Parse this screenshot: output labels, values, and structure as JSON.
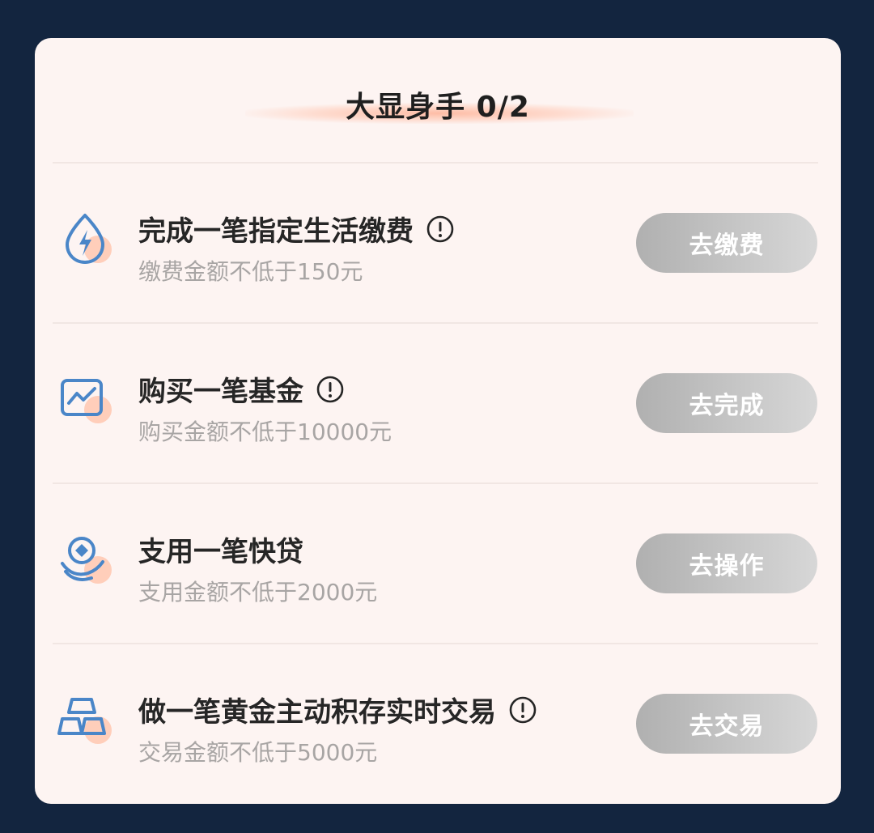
{
  "header": {
    "title": "大显身手 0/2"
  },
  "tasks": [
    {
      "icon": "water-drop-bolt-icon",
      "title": "完成一笔指定生活缴费",
      "has_info": true,
      "subtitle": "缴费金额不低于150元",
      "button_label": "去缴费"
    },
    {
      "icon": "fund-chart-icon",
      "title": "购买一笔基金",
      "has_info": true,
      "subtitle": "购买金额不低于10000元",
      "button_label": "去完成"
    },
    {
      "icon": "loan-coin-hand-icon",
      "title": "支用一笔快贷",
      "has_info": false,
      "subtitle": "支用金额不低于2000元",
      "button_label": "去操作"
    },
    {
      "icon": "gold-bars-icon",
      "title": "做一笔黄金主动积存实时交易",
      "has_info": true,
      "subtitle": "交易金额不低于5000元",
      "button_label": "去交易"
    }
  ],
  "colors": {
    "page_background": "#13253f",
    "card_background": "#fdf4f2",
    "icon_blue": "#4a86c8",
    "icon_accent": "#ffc7b0",
    "button_disabled": "#bdbdbd"
  }
}
